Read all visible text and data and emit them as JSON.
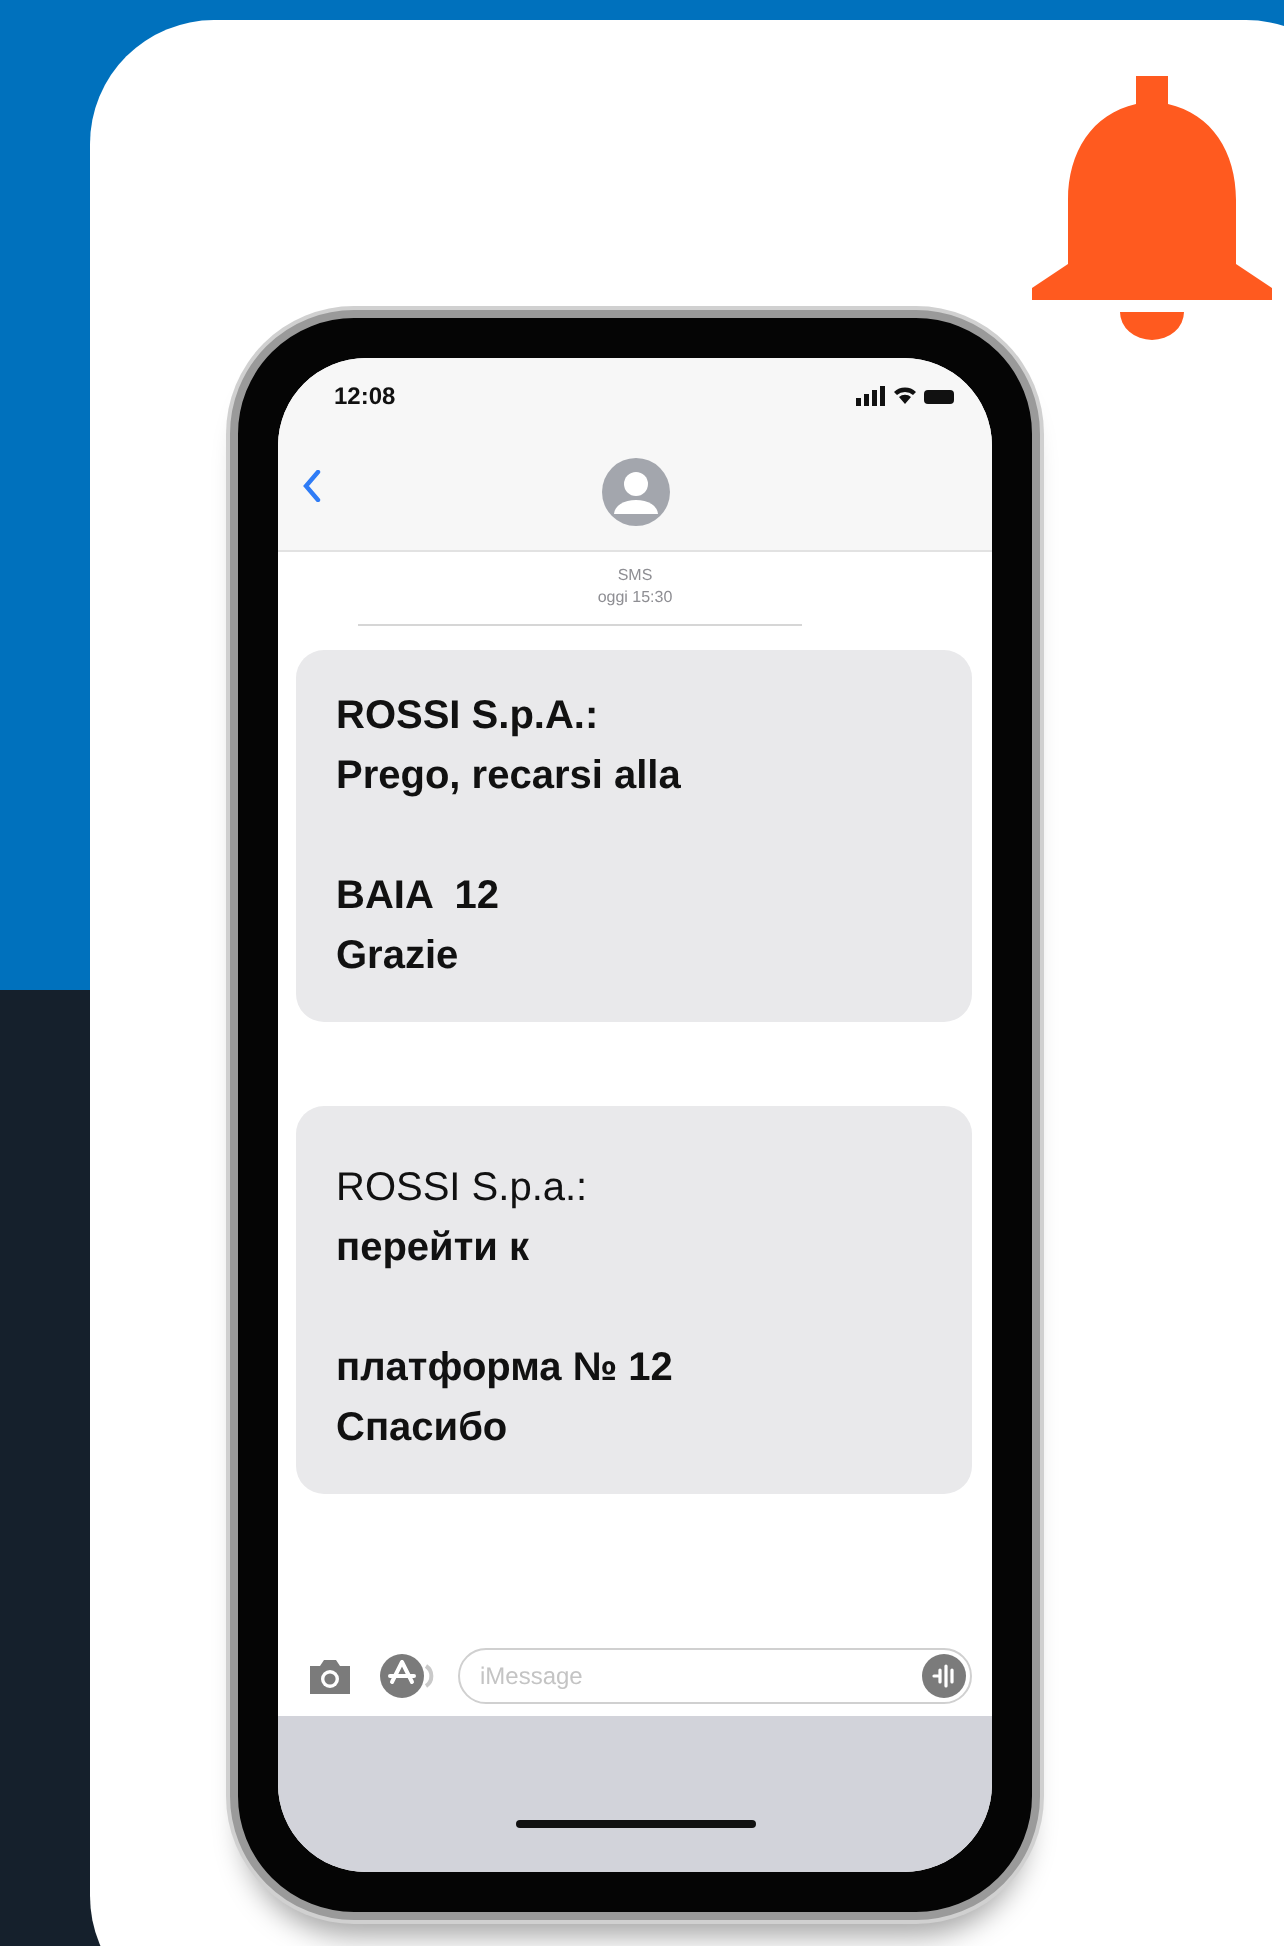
{
  "status_bar": {
    "time": "12:08"
  },
  "thread": {
    "service": "SMS",
    "timestamp": "oggi 15:30"
  },
  "messages": [
    {
      "paragraphs": [
        [
          {
            "text": "ROSSI S.p.A.:",
            "bold": true
          },
          {
            "text": "Prego, recarsi alla",
            "bold": true
          }
        ],
        [
          {
            "text": "BAIA  12",
            "bold": true
          },
          {
            "text": "Grazie",
            "bold": true
          }
        ]
      ]
    },
    {
      "paragraphs": [
        [
          {
            "text": "ROSSI S.p.a.:",
            "bold": false
          },
          {
            "text": "перейти к",
            "bold": true
          }
        ],
        [
          {
            "text": "платформа № 12",
            "bold": true
          },
          {
            "text": "Спасибо",
            "bold": true
          }
        ]
      ]
    }
  ],
  "composer": {
    "placeholder": "iMessage"
  }
}
